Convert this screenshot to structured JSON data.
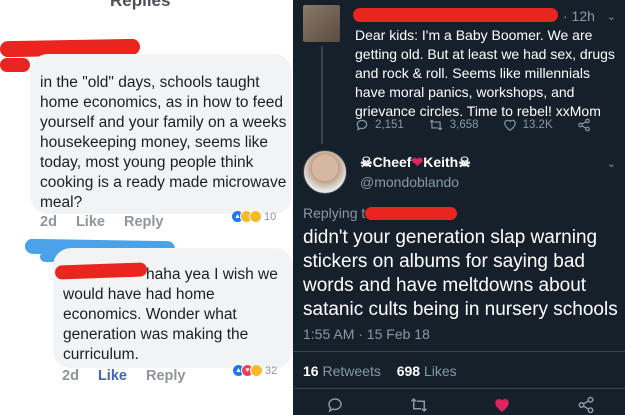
{
  "facebook": {
    "header_label": "Replies",
    "comment1": {
      "text": "in the \"old\" days, schools taught home economics, as in how to feed yourself and your family on a weeks housekeeping money, seems like today, most young people think cooking is a ready made  microwave meal?",
      "age": "2d",
      "like_label": "Like",
      "reply_label": "Reply",
      "reaction_count": "10"
    },
    "comment2": {
      "text_lead": "haha yea I wish we",
      "text": "would have had home economics. Wonder what generation was making the curriculum.",
      "age": "2d",
      "like_label": "Like",
      "reply_label": "Reply",
      "reaction_count": "32"
    }
  },
  "twitter": {
    "top_tweet": {
      "time": "· 12h",
      "text": "Dear kids: I'm a Baby Boomer. We are getting old. But at least we had sex, drugs and rock & roll. Seems like millennials have moral panics, workshops, and grievance circles. Time to rebel! xxMom",
      "replies": "2,151",
      "retweets": "3,658",
      "likes": "13.2K"
    },
    "reply_tweet": {
      "display_name": "Cheef",
      "display_name_2": "Keith",
      "handle": "@mondoblando",
      "replying_to": "Replying to",
      "text": "didn't your generation slap warning stickers on albums for saying bad words and have meltdowns about satanic cults being in nursery schools",
      "timestamp": "1:55 AM · 15 Feb 18",
      "retweet_count": "16",
      "retweet_label": "Retweets",
      "like_count": "698",
      "like_label": "Likes"
    }
  },
  "colors": {
    "redaction_red": "#e8251f",
    "redaction_blue": "#4aa3e8",
    "twitter_bg": "#15202b",
    "like_heart": "#e0245e"
  }
}
